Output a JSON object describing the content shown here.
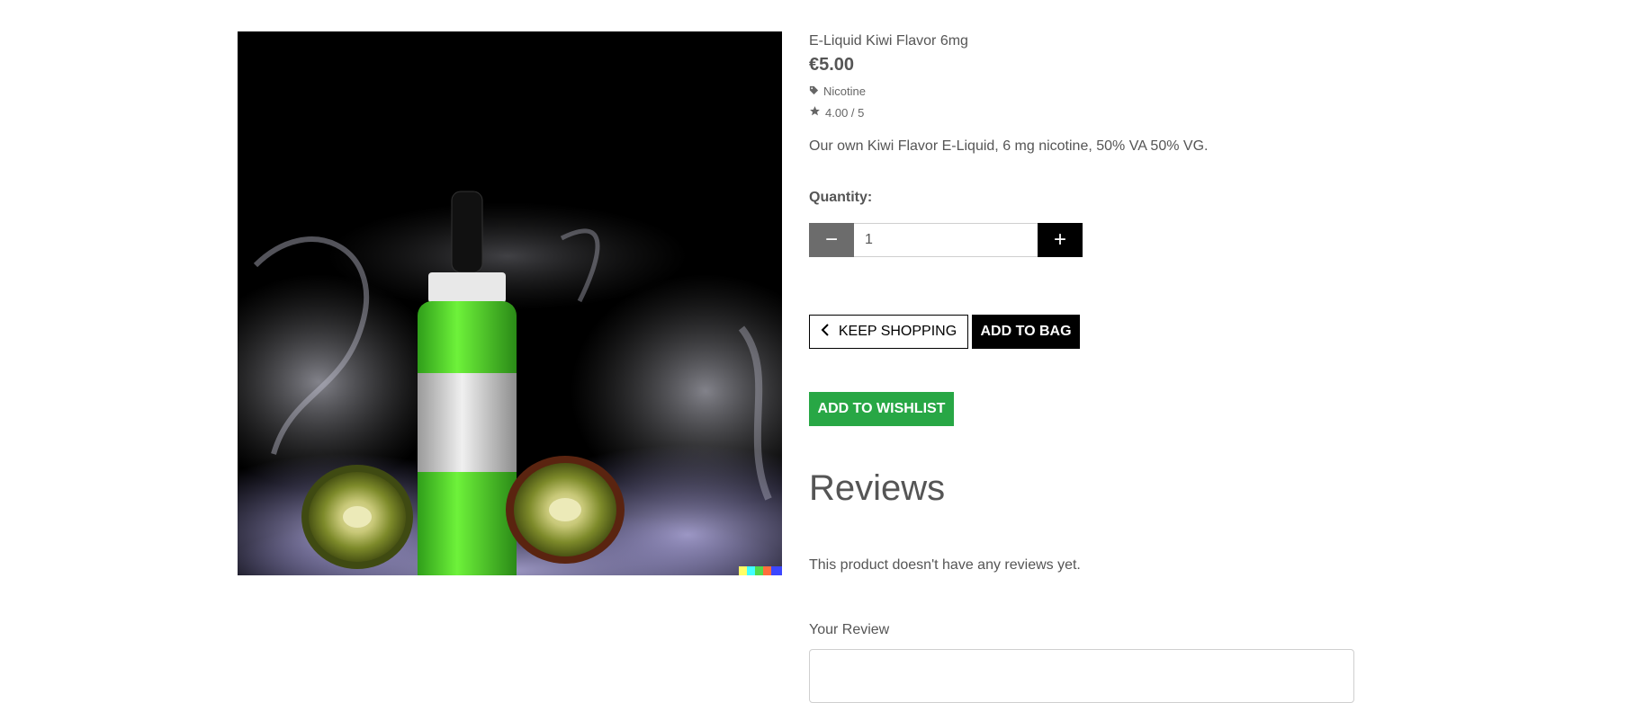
{
  "product": {
    "name": "E-Liquid Kiwi Flavor 6mg",
    "price": "€5.00",
    "category": "Nicotine",
    "rating": "4.00 / 5",
    "description": "Our own Kiwi Flavor E-Liquid, 6 mg nicotine, 50% VA 50% VG.",
    "image_icon": "kiwi-eliquid-bottle-photo"
  },
  "quantity": {
    "label": "Quantity:",
    "value": "1",
    "minus": "−",
    "plus": "+"
  },
  "actions": {
    "keep_shopping": "KEEP SHOPPING",
    "add_to_bag": "ADD TO BAG",
    "add_to_wishlist": "ADD TO WISHLIST"
  },
  "reviews": {
    "title": "Reviews",
    "empty": "This product doesn't have any reviews yet.",
    "your_review_label": "Your Review"
  },
  "colors": {
    "wishlist_green": "#28a745",
    "minus_gray": "#6c6c6c",
    "black": "#000000"
  }
}
